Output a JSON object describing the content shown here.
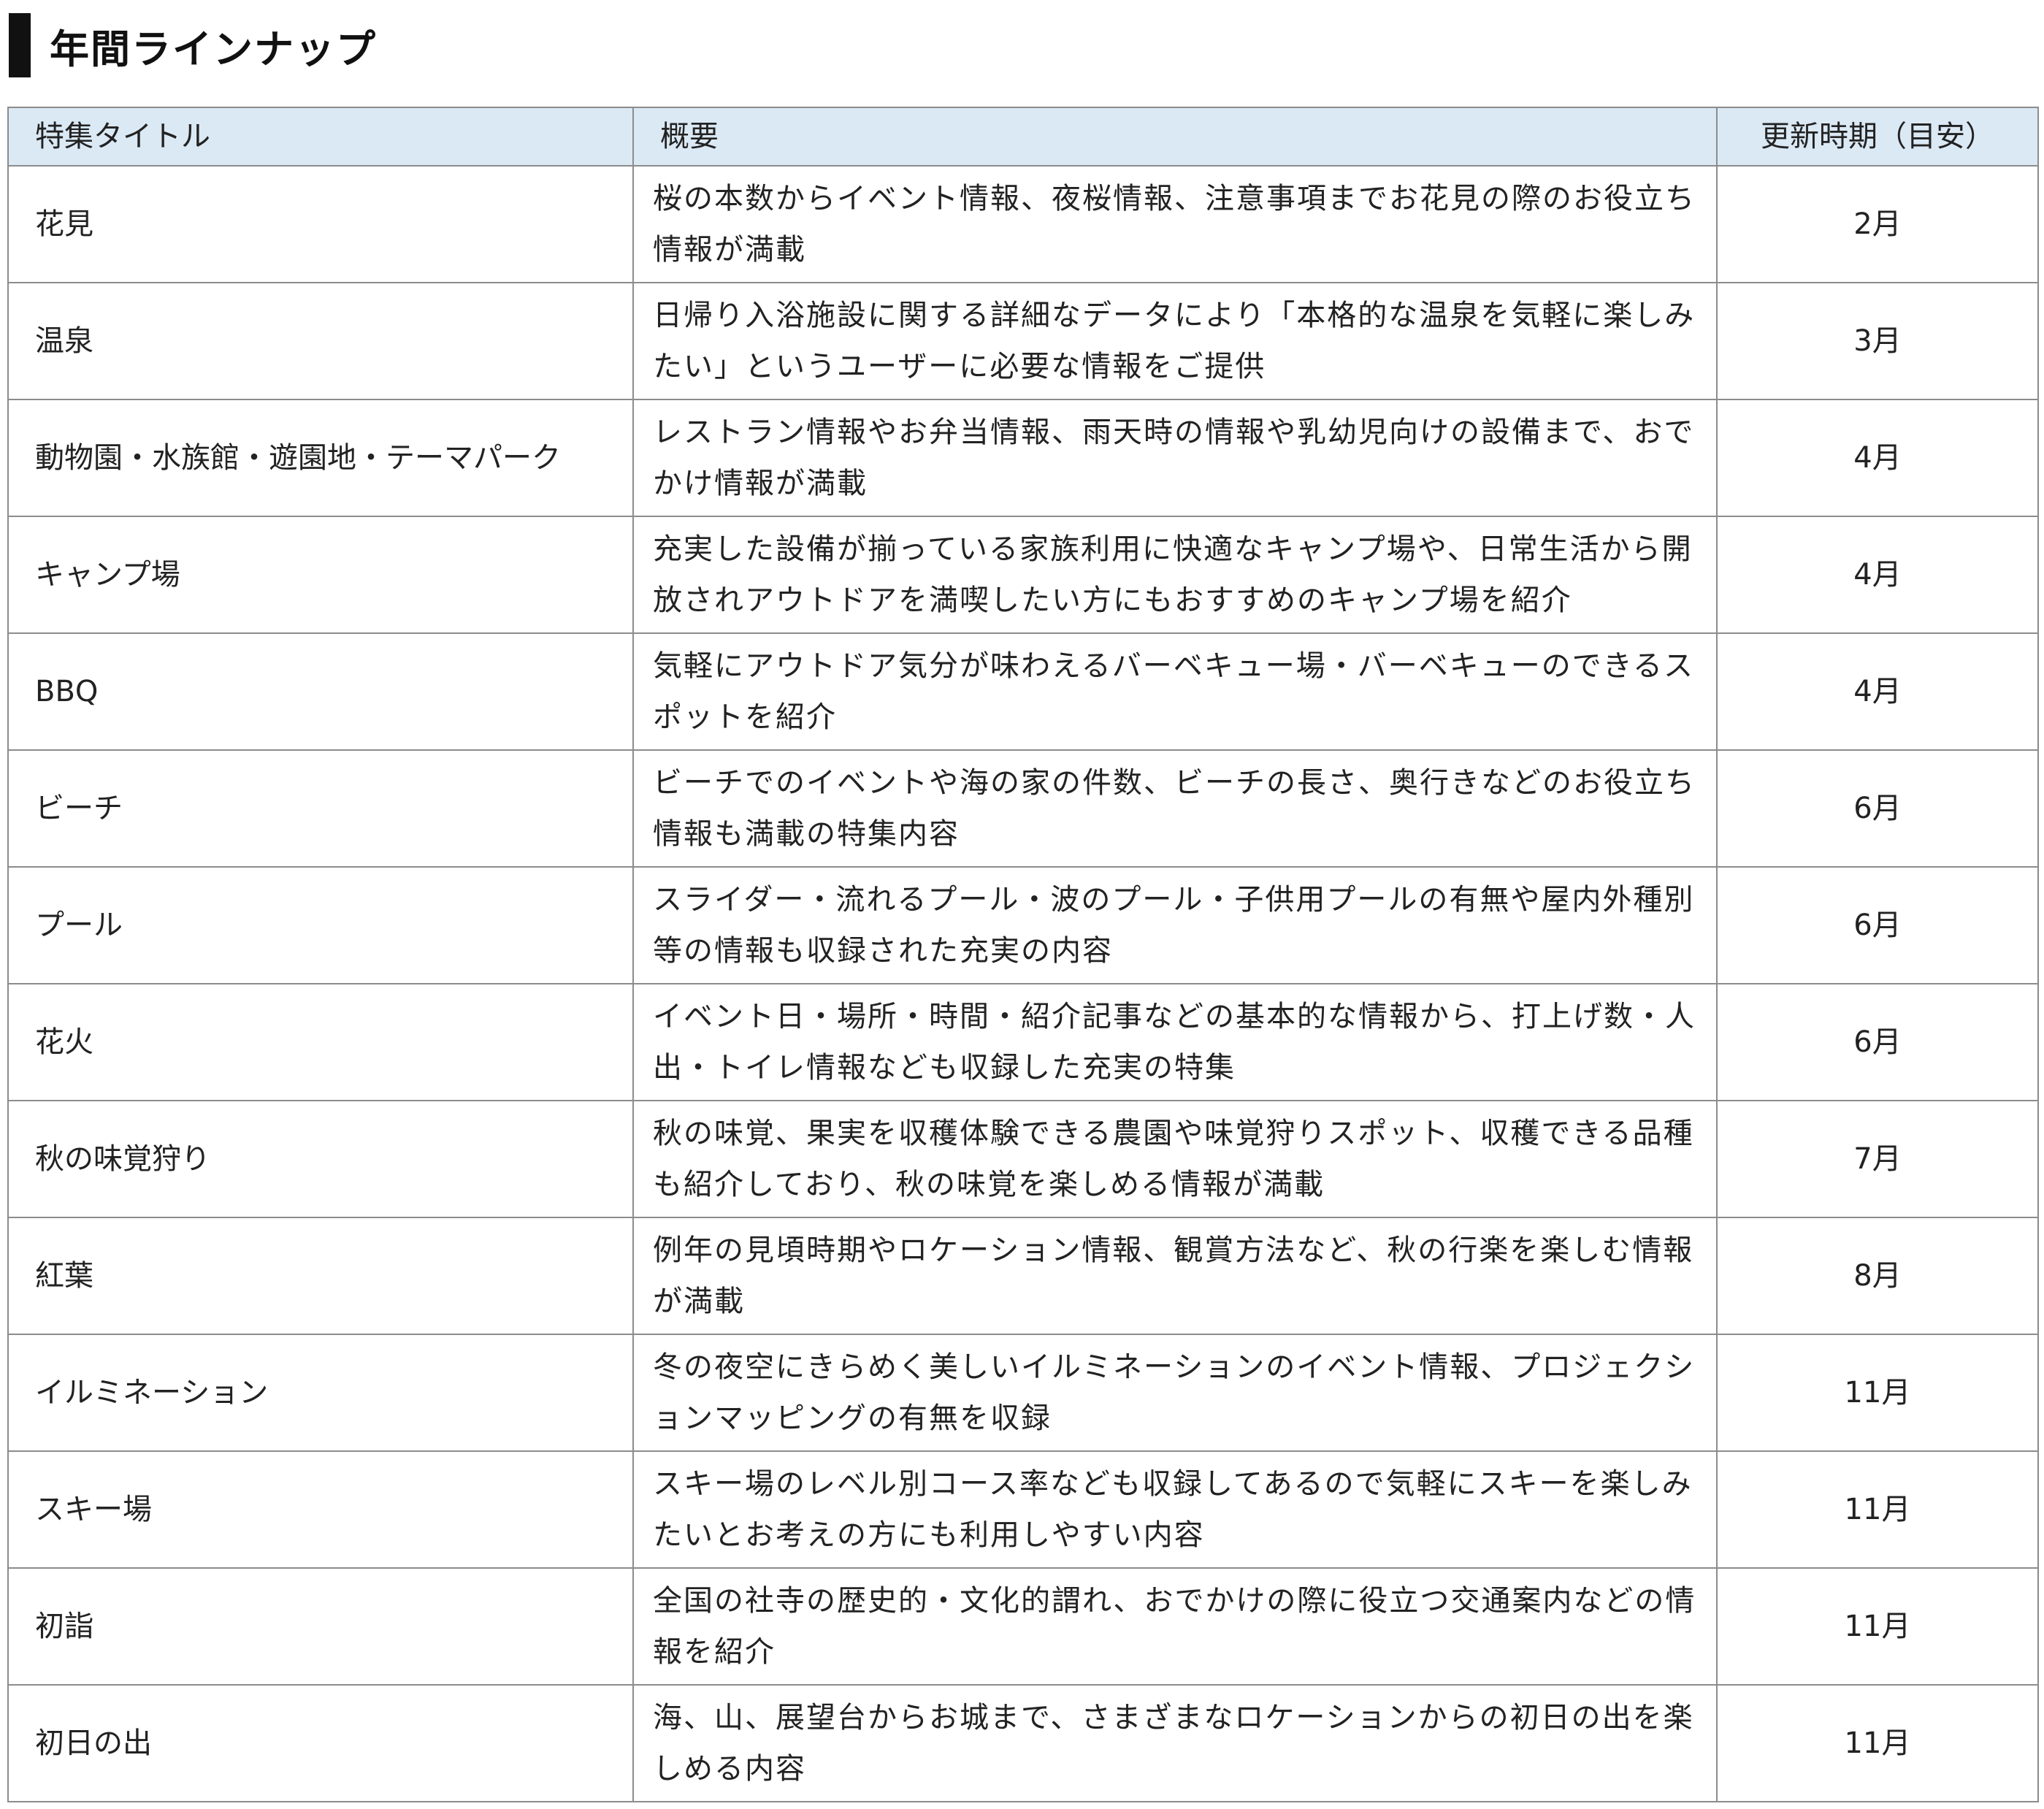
{
  "page": {
    "title": "年間ラインナップ"
  },
  "table": {
    "headers": {
      "title": "特集タイトル",
      "summary": "概要",
      "period": "更新時期（目安）"
    },
    "rows": [
      {
        "title": "花見",
        "summary": "桜の本数からイベント情報、夜桜情報、注意事項までお花見の際のお役立ち情報が満載",
        "period": "2月"
      },
      {
        "title": "温泉",
        "summary": "日帰り入浴施設に関する詳細なデータにより「本格的な温泉を気軽に楽しみたい」というユーザーに必要な情報をご提供",
        "period": "3月"
      },
      {
        "title": "動物園・水族館・遊園地・テーマパーク",
        "summary": "レストラン情報やお弁当情報、雨天時の情報や乳幼児向けの設備まで、おでかけ情報が満載",
        "period": "4月"
      },
      {
        "title": "キャンプ場",
        "summary": "充実した設備が揃っている家族利用に快適なキャンプ場や、日常生活から開放されアウトドアを満喫したい方にもおすすめのキャンプ場を紹介",
        "period": "4月"
      },
      {
        "title": "BBQ",
        "summary": "気軽にアウトドア気分が味わえるバーベキュー場・バーベキューのできるスポットを紹介",
        "period": "4月"
      },
      {
        "title": "ビーチ",
        "summary": "ビーチでのイベントや海の家の件数、ビーチの長さ、奥行きなどのお役立ち情報も満載の特集内容",
        "period": "6月"
      },
      {
        "title": "プール",
        "summary": "スライダー・流れるプール・波のプール・子供用プールの有無や屋内外種別等の情報も収録された充実の内容",
        "period": "6月"
      },
      {
        "title": "花火",
        "summary": "イベント日・場所・時間・紹介記事などの基本的な情報から、打上げ数・人出・トイレ情報なども収録した充実の特集",
        "period": "6月"
      },
      {
        "title": "秋の味覚狩り",
        "summary": "秋の味覚、果実を収穫体験できる農園や味覚狩りスポット、収穫できる品種も紹介しており、秋の味覚を楽しめる情報が満載",
        "period": "7月"
      },
      {
        "title": "紅葉",
        "summary": "例年の見頃時期やロケーション情報、観賞方法など、秋の行楽を楽しむ情報が満載",
        "period": "8月"
      },
      {
        "title": "イルミネーション",
        "summary": "冬の夜空にきらめく美しいイルミネーションのイベント情報、プロジェクションマッピングの有無を収録",
        "period": "11月"
      },
      {
        "title": "スキー場",
        "summary": "スキー場のレベル別コース率なども収録してあるので気軽にスキーを楽しみたいとお考えの方にも利用しやすい内容",
        "period": "11月"
      },
      {
        "title": "初詣",
        "summary": "全国の社寺の歴史的・文化的謂れ、おでかけの際に役立つ交通案内などの情報を紹介",
        "period": "11月"
      },
      {
        "title": "初日の出",
        "summary": "海、山、展望台からお城まで、さまざまなロケーションからの初日の出を楽しめる内容",
        "period": "11月"
      }
    ]
  }
}
